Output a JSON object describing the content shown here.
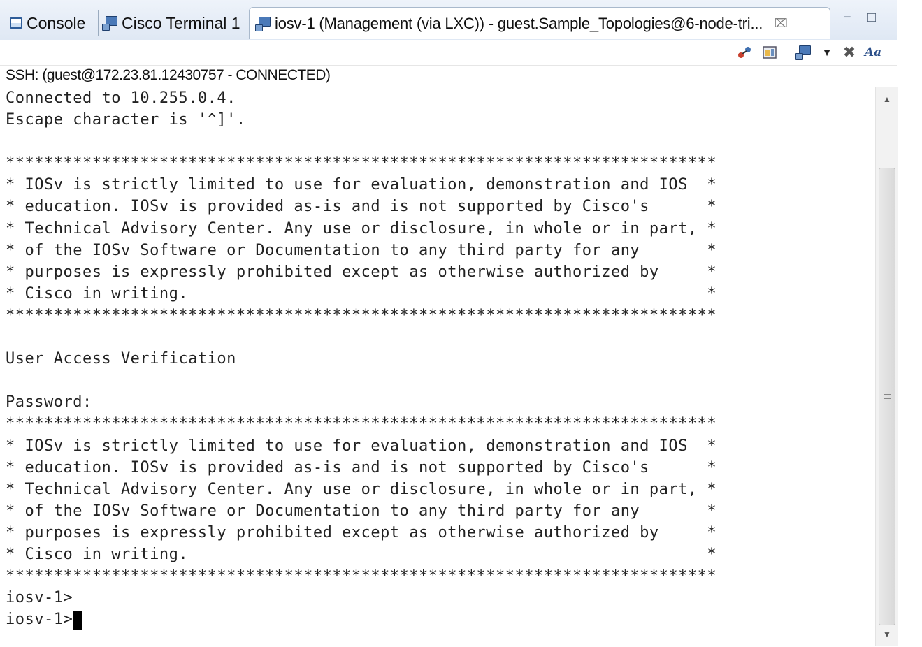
{
  "tabs": [
    {
      "label": "Console",
      "icon": "console-icon"
    },
    {
      "label": "Cisco Terminal 1",
      "icon": "terminal-icon"
    },
    {
      "label": "iosv-1  (Management (via LXC)) - guest.Sample_Topologies@6-node-tri...",
      "icon": "terminal-icon",
      "close": "⌧"
    }
  ],
  "window_buttons": {
    "minimize": "−",
    "maximize": "□"
  },
  "toolbar": [
    "connect-icon",
    "settings-icon",
    "terminal-icon",
    "dropdown-icon",
    "disconnect-icon",
    "font-icon"
  ],
  "toolbar_font_label": "Aa",
  "status": "SSH: (guest@172.23.81.12430757 - CONNECTED)",
  "terminal_lines": [
    "Connected to 10.255.0.4.",
    "Escape character is '^]'.",
    "",
    "**************************************************************************",
    "* IOSv is strictly limited to use for evaluation, demonstration and IOS  *",
    "* education. IOSv is provided as-is and is not supported by Cisco's      *",
    "* Technical Advisory Center. Any use or disclosure, in whole or in part, *",
    "* of the IOSv Software or Documentation to any third party for any       *",
    "* purposes is expressly prohibited except as otherwise authorized by     *",
    "* Cisco in writing.                                                      *",
    "**************************************************************************",
    "",
    "User Access Verification",
    "",
    "Password:",
    "**************************************************************************",
    "* IOSv is strictly limited to use for evaluation, demonstration and IOS  *",
    "* education. IOSv is provided as-is and is not supported by Cisco's      *",
    "* Technical Advisory Center. Any use or disclosure, in whole or in part, *",
    "* of the IOSv Software or Documentation to any third party for any       *",
    "* purposes is expressly prohibited except as otherwise authorized by     *",
    "* Cisco in writing.                                                      *",
    "**************************************************************************",
    "iosv-1>"
  ],
  "prompt": "iosv-1>",
  "scrollbar": {
    "up": "▲",
    "down": "▼"
  }
}
